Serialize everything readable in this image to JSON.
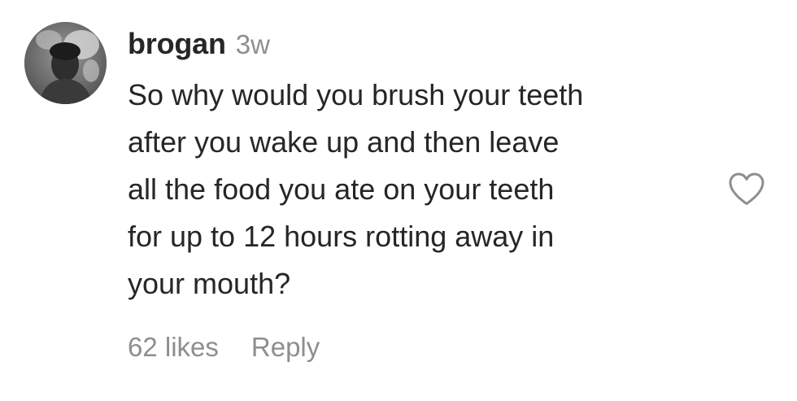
{
  "comment": {
    "avatar_icon": "user-avatar-photo",
    "username": "brogan",
    "timestamp": "3w",
    "text_lines": [
      "So why would you brush your teeth",
      "after you wake up and then leave",
      "all the food you ate on your teeth",
      "for up to 12 hours rotting away in",
      "your mouth?"
    ],
    "like_icon": "heart-outline-icon",
    "likes_label": "62 likes",
    "reply_label": "Reply"
  },
  "colors": {
    "text_primary": "#262626",
    "text_secondary": "#8e8e8e",
    "background": "#ffffff"
  }
}
